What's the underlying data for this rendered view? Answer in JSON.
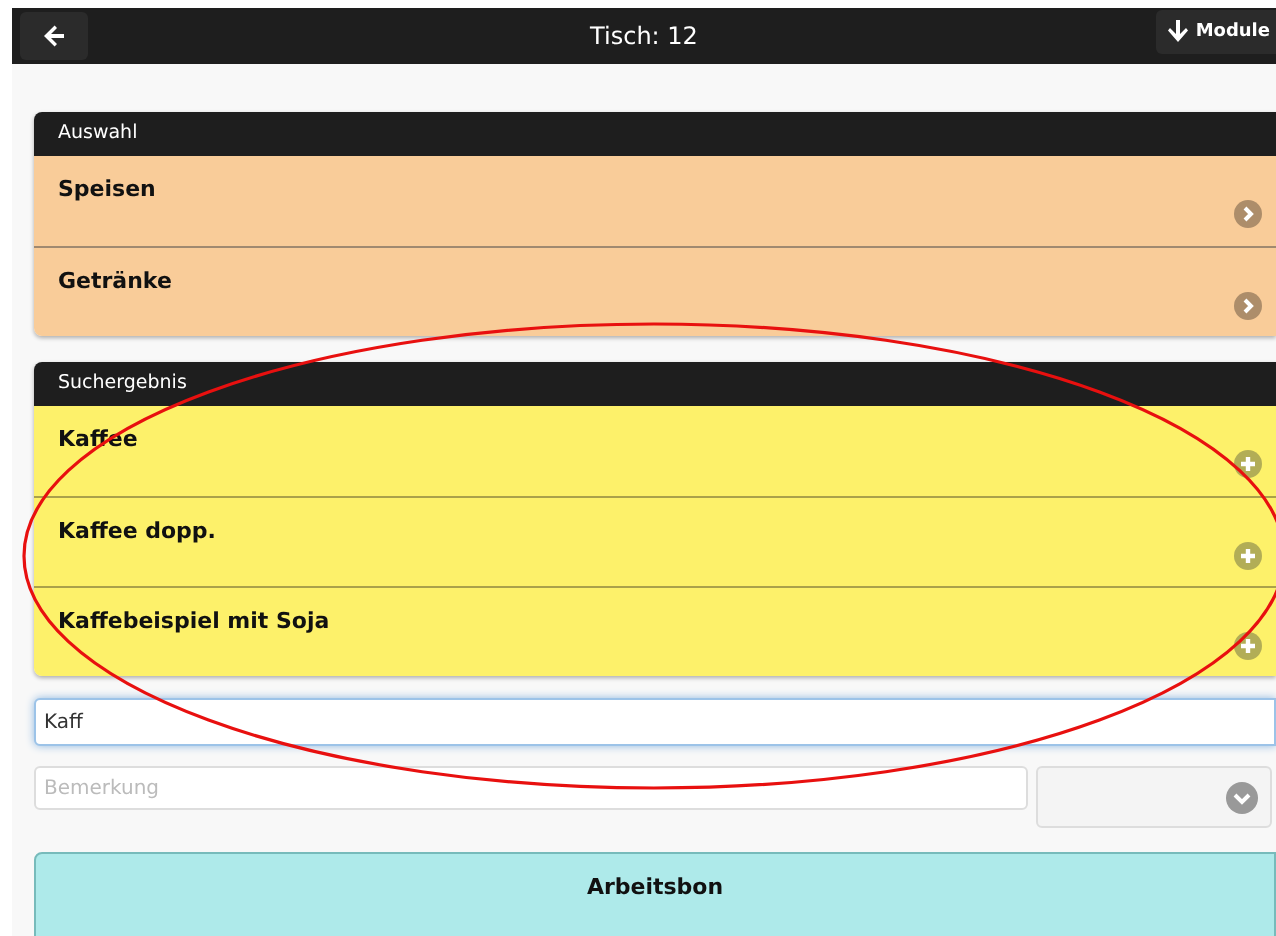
{
  "header": {
    "title": "Tisch: 12",
    "module_button": "Module"
  },
  "selection": {
    "title": "Auswahl",
    "items": [
      {
        "label": "Speisen"
      },
      {
        "label": "Getränke"
      }
    ]
  },
  "results": {
    "title": "Suchergebnis",
    "items": [
      {
        "label": "Kaffee"
      },
      {
        "label": "Kaffee dopp."
      },
      {
        "label": "Kaffebeispiel mit Soja"
      }
    ]
  },
  "search": {
    "value": "Kaff"
  },
  "remark": {
    "placeholder": "Bemerkung"
  },
  "submit_button": "Arbeitsbon"
}
